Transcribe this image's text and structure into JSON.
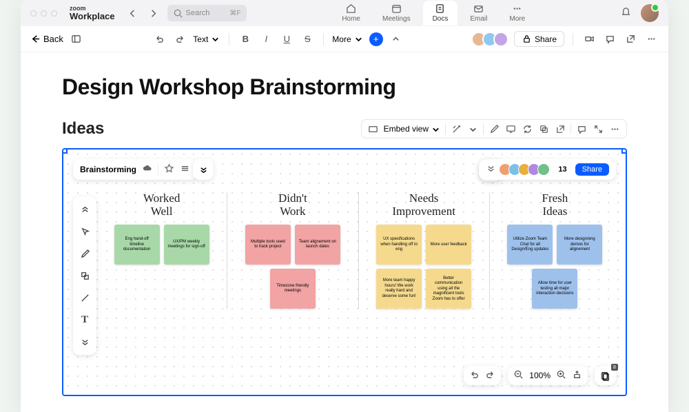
{
  "brand": {
    "top": "zoom",
    "bottom": "Workplace"
  },
  "search": {
    "placeholder": "Search",
    "kbd": "⌘F"
  },
  "nav": {
    "home": "Home",
    "meetings": "Meetings",
    "docs": "Docs",
    "email": "Email",
    "more": "More"
  },
  "toolbar": {
    "back": "Back",
    "text": "Text",
    "more": "More",
    "share": "Share"
  },
  "doc": {
    "title": "Design Workshop Brainstorming",
    "section": "Ideas"
  },
  "embed": {
    "label": "Embed view"
  },
  "whiteboard": {
    "name": "Brainstorming",
    "count": "13",
    "share": "Share",
    "zoom": "100%",
    "pages": "8"
  },
  "columns": [
    {
      "title": "Worked\nWell",
      "color": "green",
      "notes": [
        "Eng hand-off timeline documentation",
        "UX/PM weekly meetings for sign-off"
      ]
    },
    {
      "title": "Didn't\nWork",
      "color": "pink",
      "notes": [
        "Multiple tools used to track project",
        "Team alignement on launch dates",
        "Timezone friendly meetings"
      ]
    },
    {
      "title": "Needs\nImprovement",
      "color": "yellow",
      "notes": [
        "UX specifications when handling off to eng",
        "More user feedback",
        "More team happy hours! We work really hard and deserve some fun!",
        "Better communication using all the magnificent tools Zoom has to offer"
      ]
    },
    {
      "title": "Fresh\nIdeas",
      "color": "blue",
      "notes": [
        "Utilize Zoom Team Chat for all Design/Eng updates",
        "More design/eng demos for alignement",
        "Allow time for user testing all major interaction decisions"
      ]
    }
  ]
}
